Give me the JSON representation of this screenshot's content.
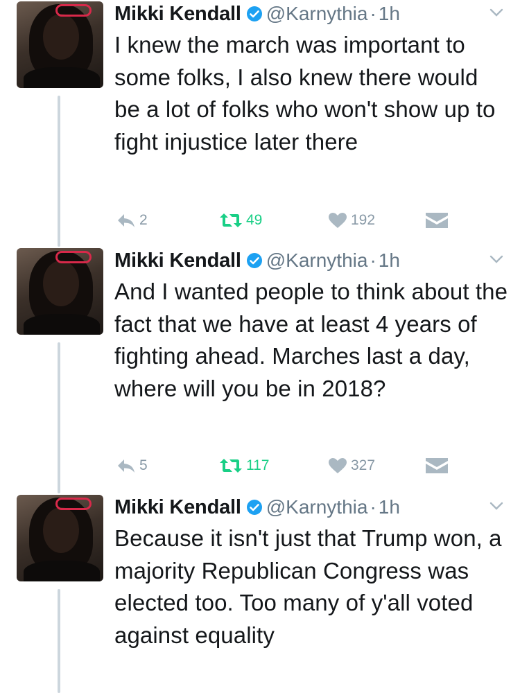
{
  "tweets": [
    {
      "name": "Mikki Kendall",
      "handle": "@Karnythia",
      "dot": "·",
      "time": "1h",
      "text": "I knew the march was important to some folks, I also knew there would be a lot of folks who won't show up to fight injustice later there",
      "replies": "2",
      "retweets": "49",
      "likes": "192"
    },
    {
      "name": "Mikki Kendall",
      "handle": "@Karnythia",
      "dot": "·",
      "time": "1h",
      "text": "And I wanted people to think about the fact that we have at least 4 years of fighting ahead. Marches last a day, where will you be in 2018?",
      "replies": "5",
      "retweets": "117",
      "likes": "327"
    },
    {
      "name": "Mikki Kendall",
      "handle": "@Karnythia",
      "dot": "·",
      "time": "1h",
      "text": "Because it isn't just that Trump won, a majority Republican Congress was elected too. Too many of y'all voted against equality",
      "replies": "",
      "retweets": "",
      "likes": ""
    }
  ],
  "icons": {
    "verified": "verified-badge-icon",
    "caret": "chevron-down-icon",
    "reply": "reply-icon",
    "retweet": "retweet-icon",
    "like": "heart-icon",
    "dm": "direct-message-icon"
  },
  "colors": {
    "verified": "#1da1f2",
    "retweeted": "#19cf86",
    "muted": "#8899a6",
    "thread_line": "#ccd6dd"
  }
}
